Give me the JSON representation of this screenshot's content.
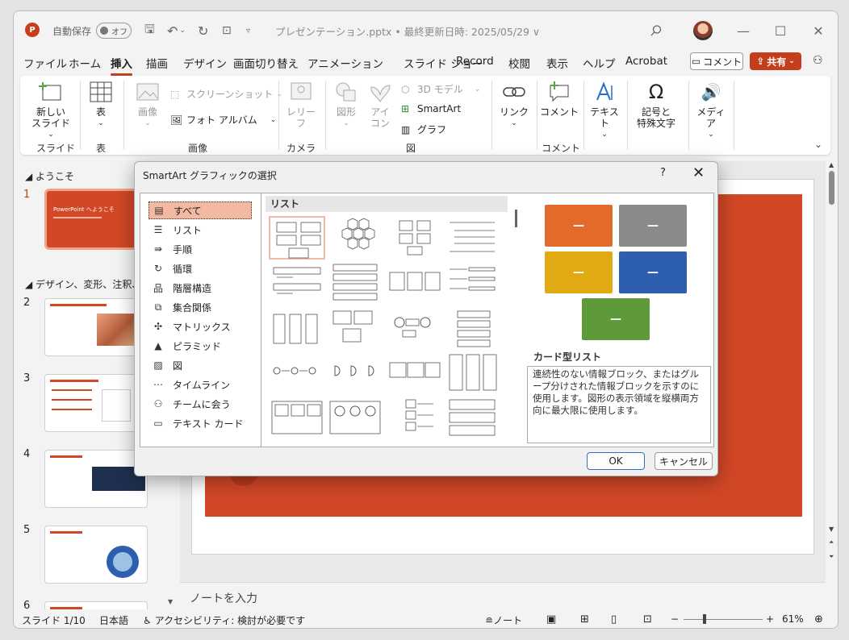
{
  "titlebar": {
    "autosave_label": "自動保存",
    "autosave_state": "オフ",
    "title": "プレゼンテーション.pptx • 最終更新日時: 2025/05/29 ∨"
  },
  "tabs": [
    "ファイル",
    "ホーム",
    "挿入",
    "描画",
    "デザイン",
    "画面切り替え",
    "アニメーション",
    "スライド ショー",
    "Record",
    "校閲",
    "表示",
    "ヘルプ",
    "Acrobat"
  ],
  "active_tab": "挿入",
  "header_buttons": {
    "comment": "コメント",
    "share": "共有"
  },
  "ribbon": {
    "new_slide": "新しい\nスライド",
    "table": "表",
    "image": "画像",
    "screenshot": "スクリーンショット",
    "photo_album": "フォト アルバム",
    "cameo": "レリー\nフ",
    "shapes": "図形",
    "icons": "アイ\nコン",
    "model3d": "3D モデル",
    "smartart": "SmartArt",
    "chart": "グラフ",
    "link": "リンク",
    "comment": "コメント",
    "text": "テキスト",
    "symbols": "記号と\n特殊文字",
    "media": "メディア",
    "groups": {
      "slides": "スライド",
      "tables": "表",
      "images": "画像",
      "camera": "カメラ",
      "illustrations": "図",
      "comments": "コメント"
    }
  },
  "thumbnails": {
    "section1": "ようこそ",
    "section2": "デザイン、変形、注釈、共",
    "numbers": [
      "1",
      "2",
      "3",
      "4",
      "5",
      "6"
    ],
    "slide1_title": "PowerPoint へようこそ"
  },
  "notes_placeholder": "ノートを入力",
  "status": {
    "slide": "スライド 1/10",
    "language": "日本語",
    "accessibility": "アクセシビリティ: 検討が必要です",
    "notes": "ノート",
    "zoom": "61%"
  },
  "dialog": {
    "title": "SmartArt グラフィックの選択",
    "help": "?",
    "categories": [
      "すべて",
      "リスト",
      "手順",
      "循環",
      "階層構造",
      "集合関係",
      "マトリックス",
      "ピラミッド",
      "図",
      "タイムライン",
      "チームに会う",
      "テキスト カード"
    ],
    "selected_category": "すべて",
    "gallery_header": "リスト",
    "preview_title": "カード型リスト",
    "preview_description": "連続性のない情報ブロック、またはグループ分けされた情報ブロックを示すのに使用します。図形の表示領域を縦横両方向に最大限に使用します。",
    "preview_box_label": "—",
    "ok": "OK",
    "cancel": "キャンセル"
  },
  "colors": {
    "accent": "#c43e1c",
    "orange": "#e26b2a",
    "gray": "#8a8a8a",
    "gold": "#e2aa12",
    "blue": "#2e5fae",
    "green": "#5f9a3a"
  }
}
